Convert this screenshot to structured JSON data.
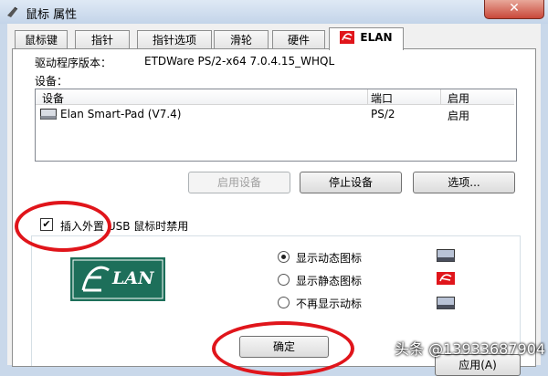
{
  "window": {
    "title": "鼠标 属性",
    "close_label": "✕"
  },
  "tabs": [
    {
      "label": "鼠标键"
    },
    {
      "label": "指针"
    },
    {
      "label": "指针选项"
    },
    {
      "label": "滑轮"
    },
    {
      "label": "硬件"
    },
    {
      "label": "ELAN"
    }
  ],
  "driver": {
    "label": "驱动程序版本：",
    "value": "ETDWare PS/2-x64 7.0.4.15_WHQL"
  },
  "devices": {
    "label": "设备：",
    "columns": [
      "设备",
      "端口",
      "启用"
    ],
    "rows": [
      {
        "name": "Elan Smart-Pad  (V7.4)",
        "port": "PS/2",
        "enabled": "启用"
      }
    ]
  },
  "buttons": {
    "enable": "启用设备",
    "stop": "停止设备",
    "options": "选项...",
    "ok": "确定",
    "apply_partial": "应用(A)"
  },
  "usb_option": {
    "label": "插入外置 USB 鼠标时禁用",
    "checked": true
  },
  "tray_options": [
    {
      "label": "显示动态图标",
      "selected": true
    },
    {
      "label": "显示静态图标",
      "selected": false
    },
    {
      "label": "不再显示动标",
      "selected": false
    }
  ],
  "logo": {
    "text": "LAN"
  },
  "watermark": "头条 @13933687904",
  "colors": {
    "accent_red": "#e0151b",
    "logo_green": "#1d6f5a",
    "titlebar": "#c9d8ea"
  }
}
